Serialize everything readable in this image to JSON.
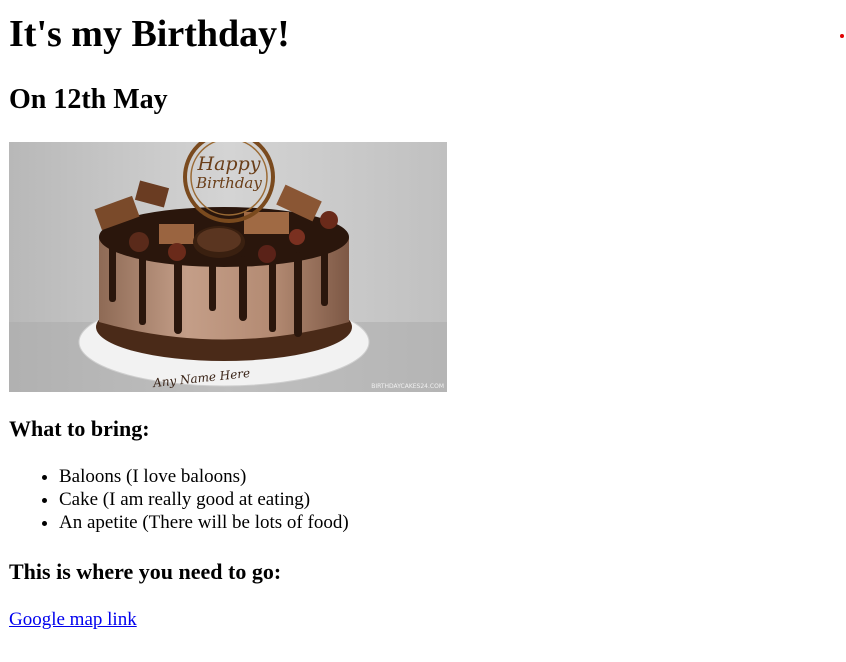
{
  "page": {
    "title": "It's my Birthday!",
    "date_heading": "On 12th May"
  },
  "image": {
    "alt": "Happy Birthday cake",
    "topper_text_line1": "Happy",
    "topper_text_line2": "Birthday",
    "plate_text": "Any Name Here",
    "watermark": "BIRTHDAYCAKES24.COM"
  },
  "bring": {
    "heading": "What to bring:",
    "items": [
      "Baloons (I love baloons)",
      "Cake (I am really good at eating)",
      "An apetite (There will be lots of food)"
    ]
  },
  "location": {
    "heading": "This is where you need to go:",
    "link_text": "Google map link"
  },
  "colors": {
    "link": "#0000ee",
    "dot": "#e00000"
  }
}
